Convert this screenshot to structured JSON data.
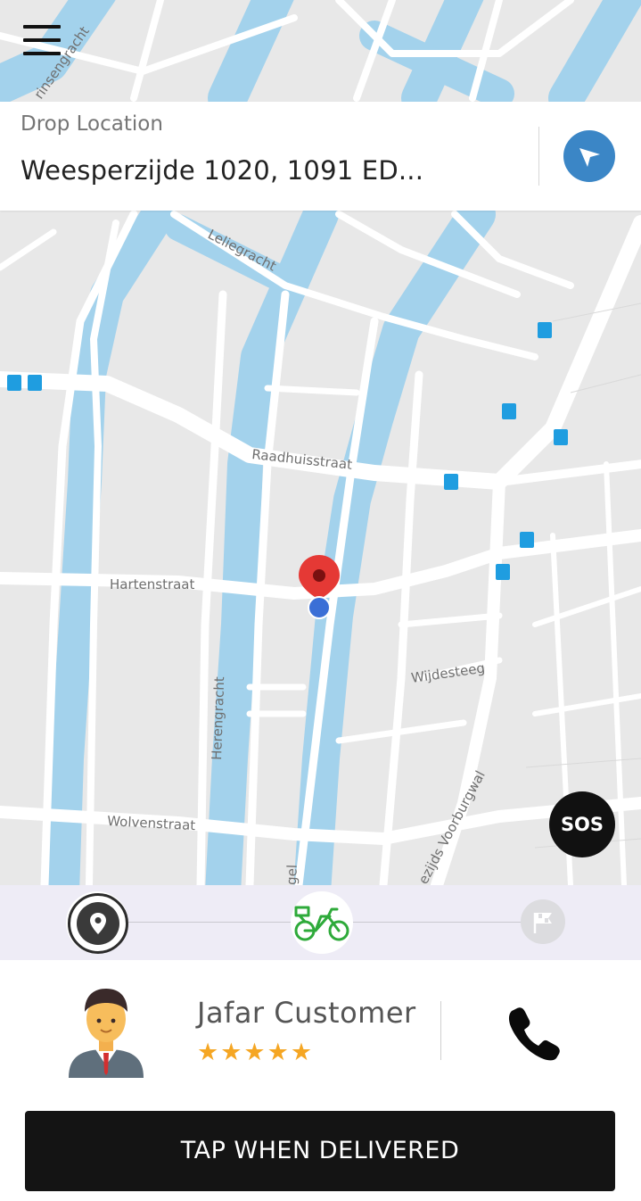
{
  "drop": {
    "label": "Drop Location",
    "address": "Weesperzijde 1020, 1091 ED..."
  },
  "map_labels": {
    "leliegracht": "Leliegracht",
    "raadhuisstraat": "Raadhuisstraat",
    "hartenstraat": "Hartenstraat",
    "herengracht": "Herengracht",
    "wijdesteeg": "Wijdesteeg",
    "wolvenstraat": "Wolvenstraat",
    "voorburgwal": "ezijds Voorburgwal",
    "prinsengracht": "rinsengracht",
    "gel": "gel"
  },
  "sos_label": "SOS",
  "customer": {
    "name": "Jafar Customer",
    "rating": 5,
    "stars": "★★★★★"
  },
  "deliver_label": "TAP WHEN DELIVERED",
  "colors": {
    "water": "#a3d2ec",
    "land": "#e8e8e8",
    "road": "#ffffff",
    "pin": "#e53935",
    "location_dot": "#3b6fd6",
    "nav_button": "#3b86c6",
    "bike_icon": "#2eaa3a",
    "star": "#f5a623"
  },
  "icons": {
    "menu": "hamburger-menu-icon",
    "navigate": "navigation-arrow-icon",
    "pickup_step": "location-pin-icon",
    "transit_step": "bicycle-icon",
    "finish_step": "checkered-flag-icon",
    "call": "phone-icon"
  }
}
